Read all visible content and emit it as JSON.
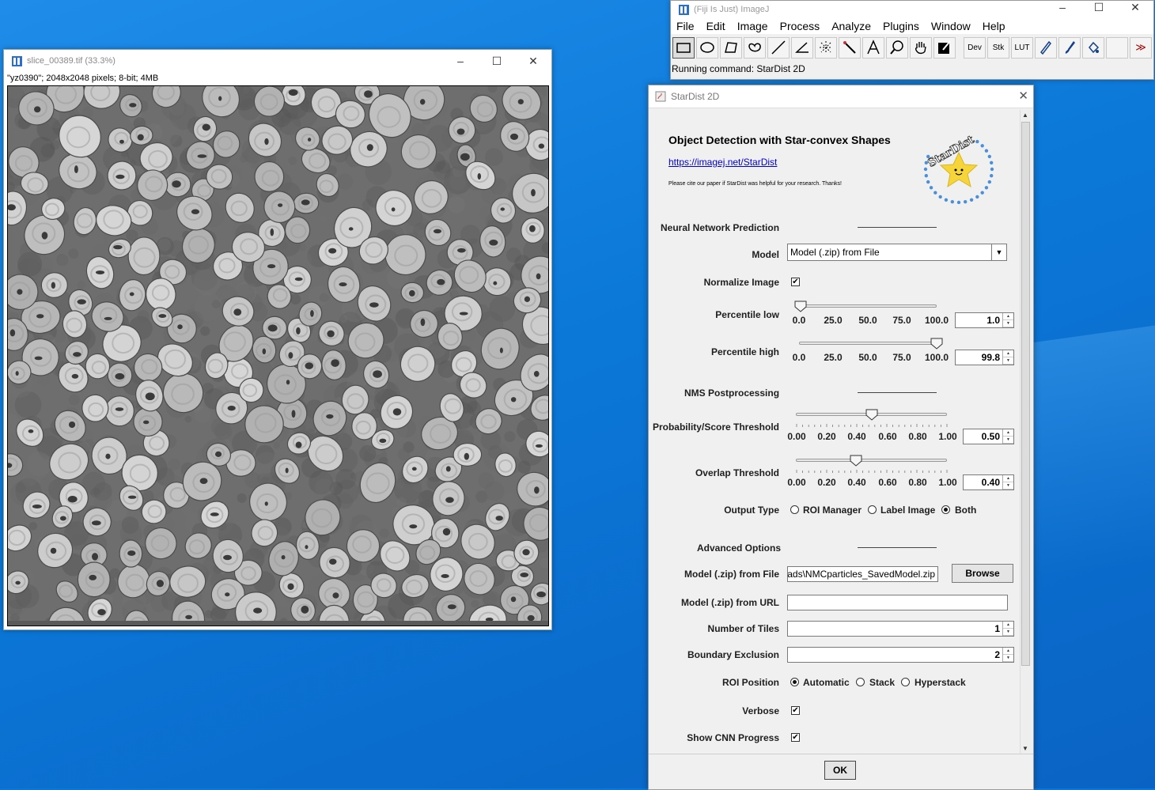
{
  "image_window": {
    "title": "slice_00389.tif (33.3%)",
    "info": "\"yz0390\"; 2048x2048 pixels; 8-bit; 4MB",
    "controls": {
      "minimize": "–",
      "maximize": "☐",
      "close": "✕"
    }
  },
  "imagej": {
    "title": "(Fiji Is Just) ImageJ",
    "menu": [
      "File",
      "Edit",
      "Image",
      "Process",
      "Analyze",
      "Plugins",
      "Window",
      "Help"
    ],
    "tools": [
      "rectangle-tool",
      "oval-tool",
      "polygon-tool",
      "freehand-tool",
      "line-tool",
      "angle-tool",
      "point-tool",
      "wand-tool",
      "text-tool",
      "magnifier-tool",
      "hand-tool",
      "color-picker-tool"
    ],
    "text_tools": {
      "dev": "Dev",
      "stk": "Stk",
      "lut": "LUT",
      "more": "≫"
    },
    "status": "Running command: StarDist 2D",
    "controls": {
      "minimize": "–",
      "maximize": "☐",
      "close": "✕"
    }
  },
  "stardist": {
    "title": "StarDist 2D",
    "heading": "Object Detection with Star-convex Shapes",
    "link": "https://imagej.net/StarDist",
    "cite": "Please cite our paper if StarDist was helpful for your research. Thanks!",
    "logo_text": "StarDist",
    "sections": {
      "nn": "Neural Network Prediction",
      "nms": "NMS Postprocessing",
      "advanced": "Advanced Options"
    },
    "labels": {
      "model": "Model",
      "normalize": "Normalize Image",
      "p_low": "Percentile low",
      "p_high": "Percentile high",
      "prob": "Probability/Score Threshold",
      "overlap": "Overlap Threshold",
      "output": "Output Type",
      "model_file": "Model (.zip) from File",
      "model_url": "Model (.zip) from URL",
      "tiles": "Number of Tiles",
      "boundary": "Boundary Exclusion",
      "roi_pos": "ROI Position",
      "verbose": "Verbose",
      "cnn": "Show CNN Progress"
    },
    "model_value": "Model (.zip) from File",
    "normalize_checked": true,
    "percentile_ticks": [
      "0.0",
      "25.0",
      "50.0",
      "75.0",
      "100.0"
    ],
    "p_low_value": "1.0",
    "p_high_value": "99.8",
    "p_low_level": 1.0,
    "p_high_level": 99.8,
    "threshold_ticks": [
      "0.00",
      "0.20",
      "0.40",
      "0.60",
      "0.80",
      "1.00"
    ],
    "prob_value": "0.50",
    "overlap_value": "0.40",
    "prob_level": 0.5,
    "overlap_level": 0.4,
    "output_options": [
      "ROI Manager",
      "Label Image",
      "Both"
    ],
    "output_selected": "Both",
    "model_file_value": "ads\\NMCparticles_SavedModel.zip",
    "browse_label": "Browse",
    "model_url_value": "",
    "tiles_value": "1",
    "boundary_value": "2",
    "roi_options": [
      "Automatic",
      "Stack",
      "Hyperstack"
    ],
    "roi_selected": "Automatic",
    "verbose_checked": true,
    "cnn_checked": true,
    "ok_label": "OK",
    "close": "✕"
  },
  "colors": {
    "desktop": "#0b78d8",
    "link": "#0000cc",
    "star": "#f6d53a",
    "logo_ring": "#4a90d9"
  }
}
